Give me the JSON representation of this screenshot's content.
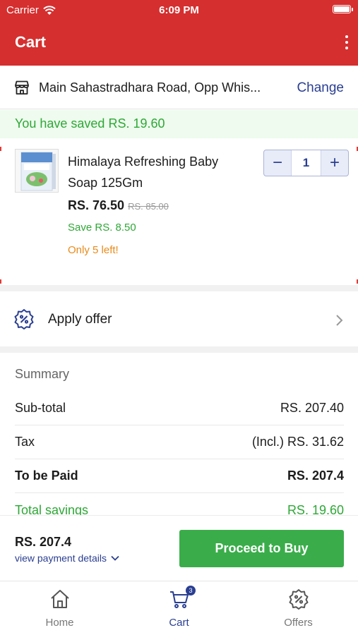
{
  "status_bar": {
    "carrier": "Carrier",
    "time": "6:09 PM"
  },
  "header": {
    "title": "Cart",
    "more_icon": "more-vertical-icon"
  },
  "colors": {
    "brand_red": "#d52f2f",
    "accent_blue": "#2a3f91",
    "success_green": "#2ea836",
    "button_green": "#3aad4a",
    "warning_orange": "#e88b1a"
  },
  "address": {
    "icon": "store-icon",
    "text": "Main Sahastradhara Road, Opp Whis...",
    "change_label": "Change"
  },
  "savings_banner": {
    "text": "You have saved RS. 19.60"
  },
  "cart_item": {
    "name": "Himalaya Refreshing Baby Soap 125Gm",
    "price": "RS. 76.50",
    "mrp": "RS. 85.00",
    "save_text": "Save RS. 8.50",
    "stock_text": "Only 5 left!",
    "quantity": "1",
    "decrement": "−",
    "increment": "+"
  },
  "offer": {
    "icon": "discount-badge-icon",
    "label": "Apply offer"
  },
  "summary": {
    "title": "Summary",
    "rows": [
      {
        "label": "Sub-total",
        "value": "RS. 207.40"
      },
      {
        "label": "Tax",
        "value": "(Incl.) RS. 31.62"
      },
      {
        "label": "To be Paid",
        "value": "RS. 207.4"
      },
      {
        "label": "Total savings",
        "value": "RS. 19.60"
      }
    ]
  },
  "checkout": {
    "total": "RS. 207.4",
    "details_link": "view payment details",
    "proceed_label": "Proceed to Buy"
  },
  "tabs": [
    {
      "label": "Home",
      "icon": "home-icon"
    },
    {
      "label": "Cart",
      "icon": "cart-icon",
      "badge": "3"
    },
    {
      "label": "Offers",
      "icon": "discount-badge-icon"
    }
  ]
}
